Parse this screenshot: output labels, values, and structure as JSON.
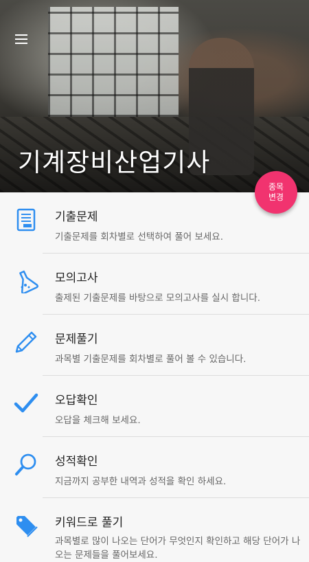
{
  "header": {
    "title": "기계장비산업기사",
    "fab_label_line1": "종목",
    "fab_label_line2": "변경"
  },
  "menu": [
    {
      "icon": "document-list-icon",
      "title": "기출문제",
      "desc": "기출문제를 회차별로 선택하여 풀어 보세요."
    },
    {
      "icon": "flask-icon",
      "title": "모의고사",
      "desc": "출제된 기출문제를 바탕으로 모의고사를 실시 합니다."
    },
    {
      "icon": "pencil-icon",
      "title": "문제풀기",
      "desc": "과목별 기출문제를 회차별로 풀어 볼 수 있습니다."
    },
    {
      "icon": "checkmark-icon",
      "title": "오답확인",
      "desc": "오답을 체크해 보세요."
    },
    {
      "icon": "magnifier-icon",
      "title": "성적확인",
      "desc": "지금까지 공부한 내역과 성적을 확인 하세요."
    },
    {
      "icon": "tag-icon",
      "title": "키워드로 풀기",
      "desc": "과목별로 많이 나오는 단어가 무엇인지 확인하고 해당 단어가 나오는 문제들을 풀어보세요."
    }
  ],
  "colors": {
    "accent": "#2e8ef0",
    "fab": "#f1336f"
  }
}
